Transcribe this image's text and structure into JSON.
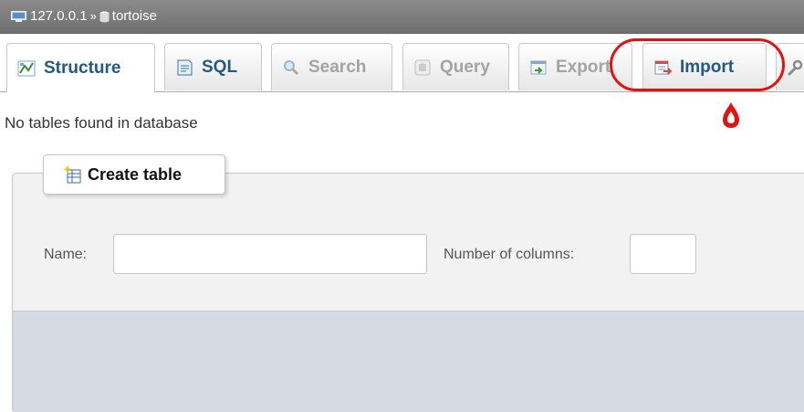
{
  "breadcrumb": {
    "server_icon": "server-icon",
    "server": "127.0.0.1",
    "separator": "»",
    "db_icon": "database-icon",
    "database": "tortoise"
  },
  "tabs": [
    {
      "label": "Structure",
      "icon": "structure-icon",
      "state": "active"
    },
    {
      "label": "SQL",
      "icon": "sql-icon",
      "state": "normal"
    },
    {
      "label": "Search",
      "icon": "search-icon",
      "state": "disabled"
    },
    {
      "label": "Query",
      "icon": "query-icon",
      "state": "disabled"
    },
    {
      "label": "Export",
      "icon": "export-icon",
      "state": "disabled"
    },
    {
      "label": "Import",
      "icon": "import-icon",
      "state": "normal"
    }
  ],
  "annotation": {
    "number": "۵",
    "color": "#e31212"
  },
  "message": "No tables found in database",
  "create_table": {
    "legend": "Create table",
    "name_label": "Name:",
    "name_value": "",
    "columns_label": "Number of columns:",
    "columns_value": ""
  },
  "colors": {
    "accent": "#235a81",
    "disabled": "#a3a3a3",
    "breadcrumb_bg": "#7d7d7d"
  }
}
